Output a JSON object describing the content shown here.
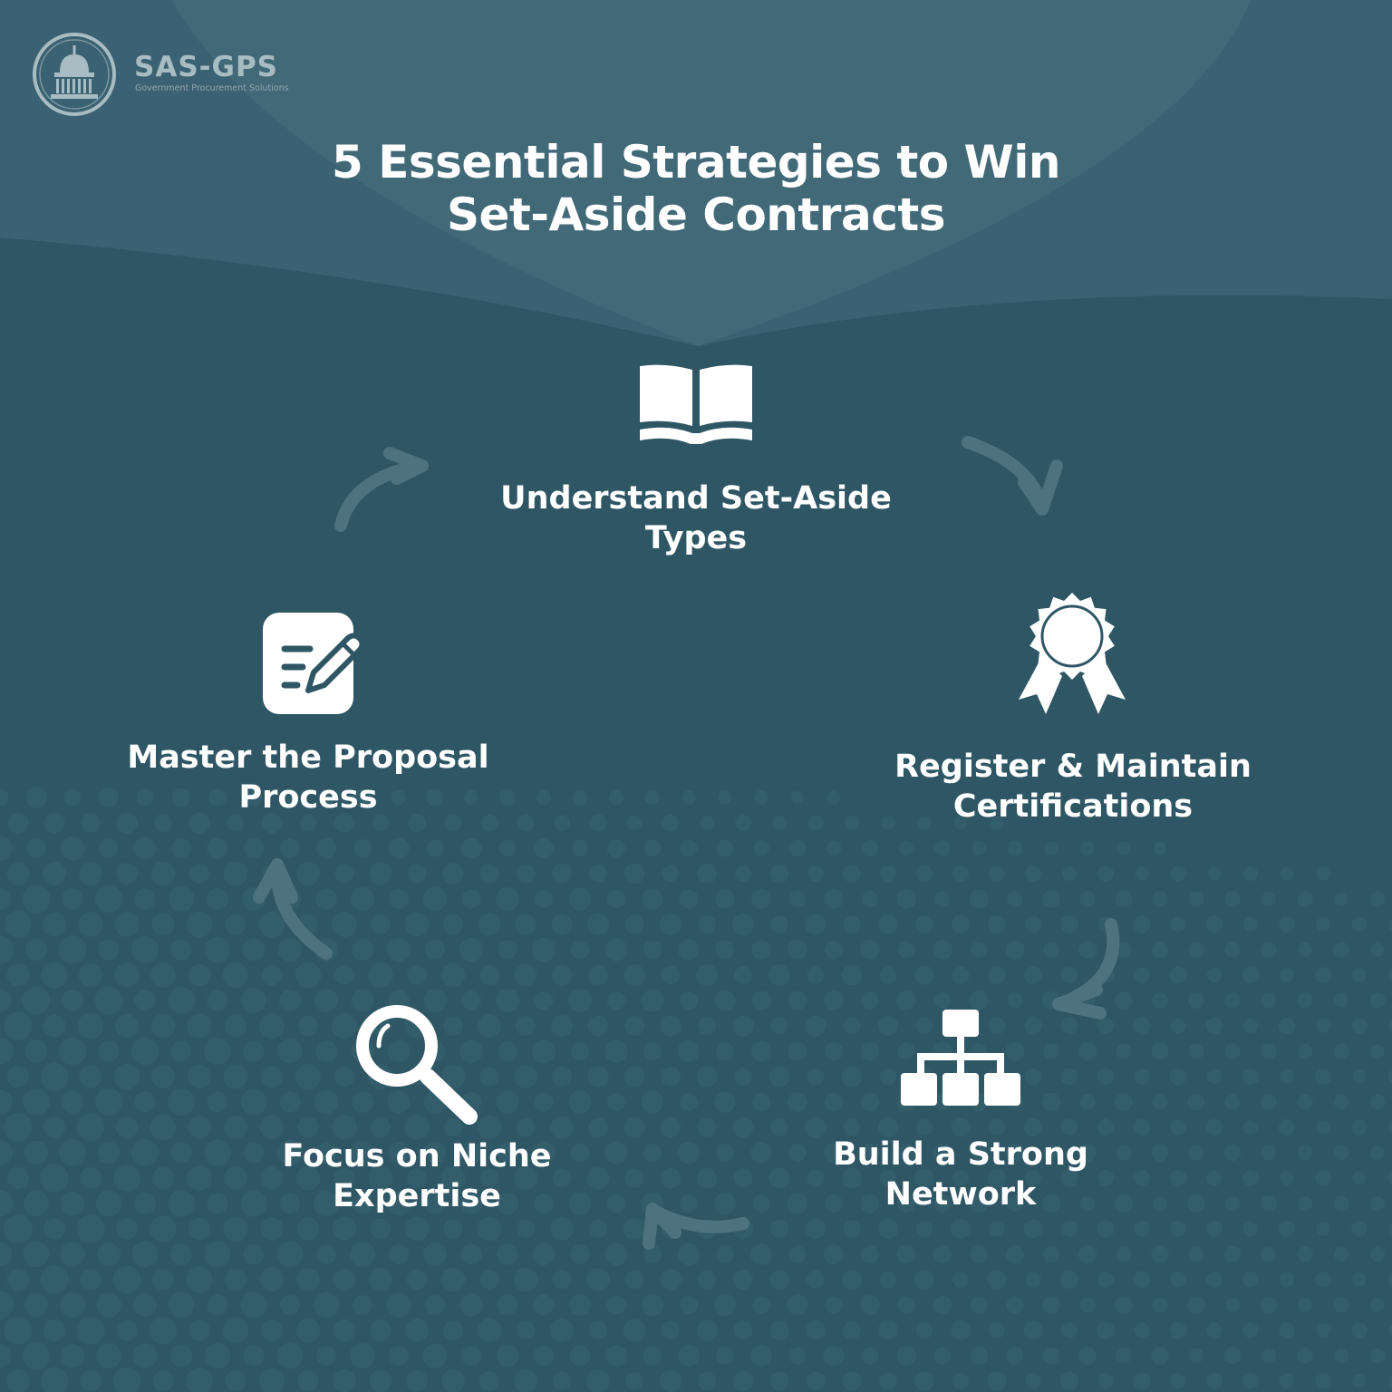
{
  "brand": {
    "name": "SAS-GPS",
    "tagline": "Government Procurement Solutions",
    "logo_icon": "capitol-dome-icon"
  },
  "title": {
    "line1": "5 Essential Strategies to Win",
    "line2": "Set-Aside Contracts"
  },
  "cycle": [
    {
      "id": "understand",
      "icon": "open-book-icon",
      "line1": "Understand Set-Aside",
      "line2": "Types"
    },
    {
      "id": "register",
      "icon": "award-ribbon-icon",
      "line1": "Register & Maintain",
      "line2": "Certifications"
    },
    {
      "id": "network",
      "icon": "hierarchy-network-icon",
      "line1": "Build a Strong",
      "line2": "Network"
    },
    {
      "id": "niche",
      "icon": "magnifying-glass-icon",
      "line1": "Focus on Niche",
      "line2": "Expertise"
    },
    {
      "id": "proposal",
      "icon": "edit-document-icon",
      "line1": "Master the Proposal",
      "line2": "Process"
    }
  ],
  "colors": {
    "background": "#2f5664",
    "header_arc": "#436a7b",
    "arrow": "#4e7380",
    "text": "#ffffff",
    "logo": "#a8bcc4"
  }
}
